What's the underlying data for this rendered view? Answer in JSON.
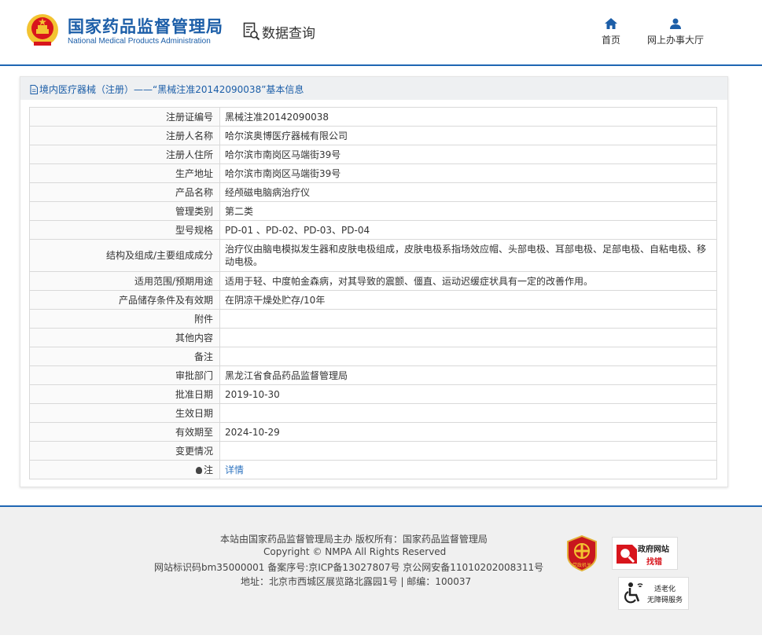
{
  "header": {
    "org_cn": "国家药品监督管理局",
    "org_en": "National Medical Products Administration",
    "section_title": "数据查询",
    "nav": [
      {
        "label": "首页",
        "icon": "home-icon"
      },
      {
        "label": "网上办事大厅",
        "icon": "user-icon"
      }
    ]
  },
  "breadcrumb": "境内医疗器械（注册）——“黑械注准20142090038”基本信息",
  "rows": [
    {
      "label": "注册证编号",
      "value": "黑械注准20142090038"
    },
    {
      "label": "注册人名称",
      "value": "哈尔滨奥博医疗器械有限公司"
    },
    {
      "label": "注册人住所",
      "value": "哈尔滨市南岗区马端街39号"
    },
    {
      "label": "生产地址",
      "value": "哈尔滨市南岗区马端街39号"
    },
    {
      "label": "产品名称",
      "value": "经颅磁电脑病治疗仪"
    },
    {
      "label": "管理类别",
      "value": "第二类"
    },
    {
      "label": "型号规格",
      "value": "PD-01 、PD-02、PD-03、PD-04"
    },
    {
      "label": "结构及组成/主要组成成分",
      "value": "治疗仪由脑电模拟发生器和皮肤电极组成，皮肤电极系指场效应帽、头部电极、耳部电极、足部电极、自粘电极、移动电极。"
    },
    {
      "label": "适用范围/预期用途",
      "value": "适用于轻、中度帕金森病，对其导致的震颤、僵直、运动迟缓症状具有一定的改善作用。"
    },
    {
      "label": "产品储存条件及有效期",
      "value": "在阴凉干燥处贮存/10年"
    },
    {
      "label": "附件",
      "value": ""
    },
    {
      "label": "其他内容",
      "value": ""
    },
    {
      "label": "备注",
      "value": ""
    },
    {
      "label": "审批部门",
      "value": "黑龙江省食品药品监督管理局"
    },
    {
      "label": "批准日期",
      "value": "2019-10-30"
    },
    {
      "label": "生效日期",
      "value": ""
    },
    {
      "label": "有效期至",
      "value": "2024-10-29"
    },
    {
      "label": "变更情况",
      "value": ""
    }
  ],
  "note": {
    "label": "注",
    "link": "详情"
  },
  "footer": {
    "line1": "本站由国家药品监督管理局主办 版权所有：国家药品监督管理局",
    "line2": "Copyright © NMPA All Rights Reserved",
    "line3": "网站标识码bm35000001    备案序号:京ICP备13027807号  京公网安备11010202008311号",
    "line4": "地址：北京市西城区展览路北露园1号 | 邮编：100037",
    "badge_label": "党政机关",
    "gov_line1": "政府网站",
    "gov_line2": "找错",
    "acc_line1": "适老化",
    "acc_line2": "无障碍服务"
  },
  "colors": {
    "brand_blue": "#1c5ea8",
    "link_blue": "#2f74c0",
    "accent_red": "#d8151c"
  }
}
